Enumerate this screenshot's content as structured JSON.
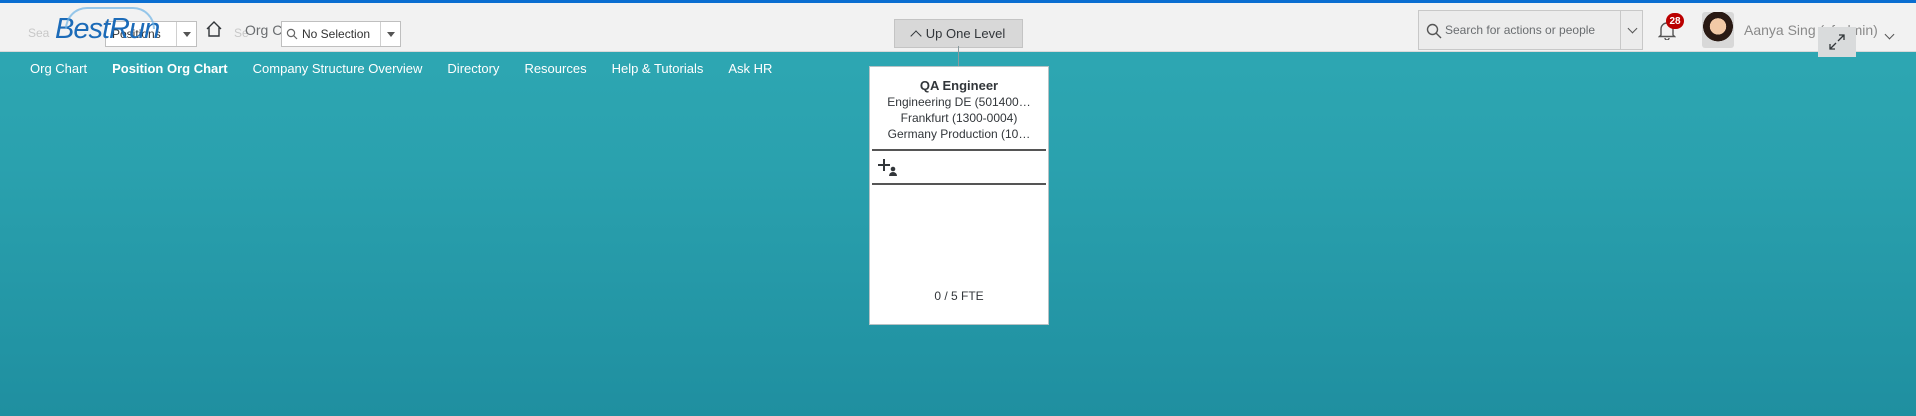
{
  "shell": {
    "logo_text": "BestRun",
    "ghost_left": "Sea",
    "ghost_mid": "Se",
    "search_type_value": "Positions",
    "breadcrumb": "Org Chart",
    "breadcrumb_close": "×",
    "selection_value": "No Selection",
    "up_one_level": "Up One Level",
    "search_placeholder": "Search for actions or people",
    "notification_count": "28",
    "user_name": "Aanya Sing (sfadmin)"
  },
  "nav": {
    "items": [
      {
        "label": "Org Chart",
        "active": false
      },
      {
        "label": "Position Org Chart",
        "active": true
      },
      {
        "label": "Company Structure Overview",
        "active": false
      },
      {
        "label": "Directory",
        "active": false
      },
      {
        "label": "Resources",
        "active": false
      },
      {
        "label": "Help & Tutorials",
        "active": false
      },
      {
        "label": "Ask HR",
        "active": false
      }
    ]
  },
  "position_card": {
    "title": "QA Engineer",
    "department": "Engineering DE (501400…",
    "location": "Frankfurt (1300-0004)",
    "company": "Germany Production (10…",
    "fte": "0 / 5 FTE"
  },
  "colors": {
    "brand": "#1c6bb8",
    "background_teal": "#2aa1ae",
    "badge": "#bb0000"
  }
}
